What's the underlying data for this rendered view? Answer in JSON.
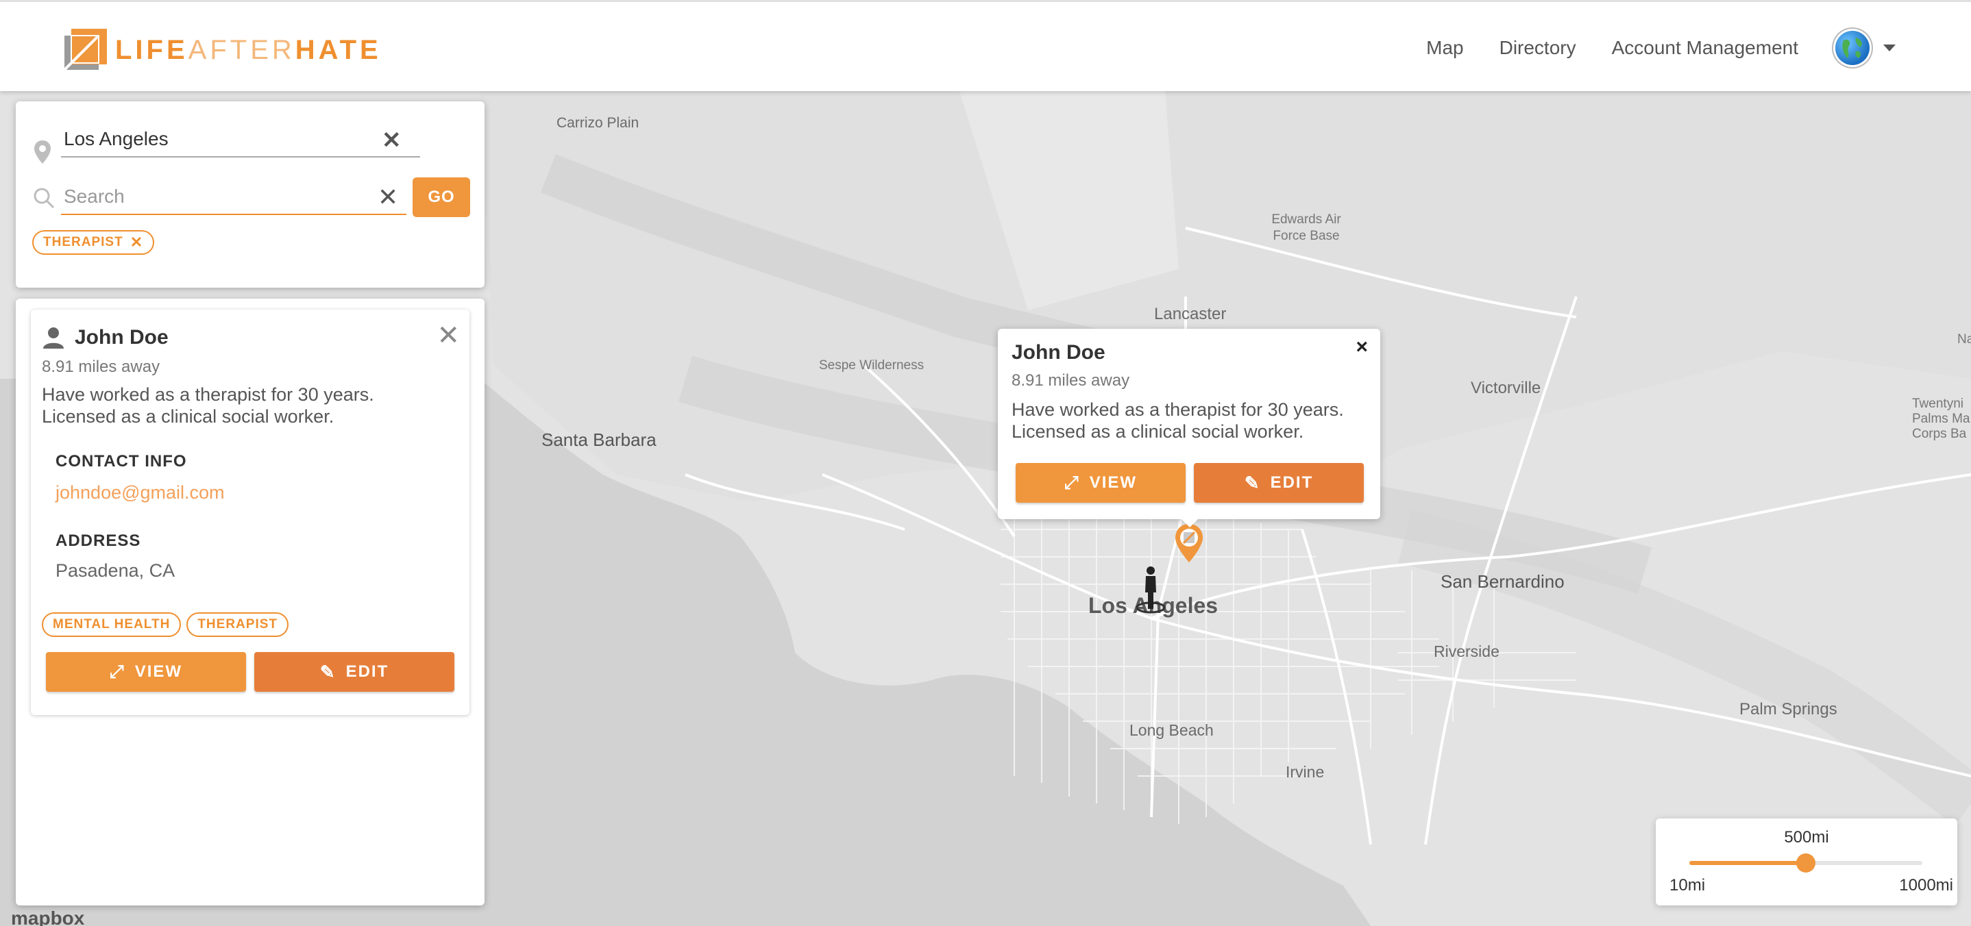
{
  "brand": {
    "name_part1": "LIFE",
    "name_part2": "AFTER",
    "name_part3": "HATE",
    "accent_color": "#ef8f2f"
  },
  "nav": {
    "items": [
      "Map",
      "Directory",
      "Account Management"
    ],
    "language_icon": "globe-icon"
  },
  "search": {
    "location_value": "Los Angeles",
    "search_placeholder": "Search",
    "go_label": "GO",
    "filter_chips": [
      "THERAPIST"
    ]
  },
  "result_card": {
    "name": "John Doe",
    "distance": "8.91 miles away",
    "description": "Have worked as a therapist for 30 years. Licensed as a clinical social worker.",
    "contact_heading": "CONTACT INFO",
    "email": "johndoe@gmail.com",
    "address_heading": "ADDRESS",
    "address": "Pasadena, CA",
    "tags": [
      "MENTAL HEALTH",
      "THERAPIST"
    ],
    "view_label": "VIEW",
    "edit_label": "EDIT"
  },
  "popup": {
    "name": "John Doe",
    "distance": "8.91 miles away",
    "description": "Have worked as a therapist for 30 years. Licensed as a clinical social worker.",
    "close_label": "×",
    "view_label": "VIEW",
    "edit_label": "EDIT"
  },
  "map": {
    "labels": {
      "carrizo_plain": "Carrizo Plain",
      "edwards_afb": "Edwards Air Force Base",
      "lancaster": "Lancaster",
      "sespe": "Sespe Wilderness",
      "victorville": "Victorville",
      "santa_barbara": "Santa Barbara",
      "los_angeles": "Los Angeles",
      "san_bernardino": "San Bernardino",
      "riverside": "Riverside",
      "long_beach": "Long Beach",
      "irvine": "Irvine",
      "palm_springs": "Palm Springs",
      "twentynine_palms": "Twentyni Palms Ma Corps Ba",
      "na": "Na"
    },
    "attribution": "mapbox"
  },
  "radius": {
    "current_label": "500mi",
    "min_label": "10mi",
    "max_label": "1000mi",
    "value_fraction": 0.5
  }
}
